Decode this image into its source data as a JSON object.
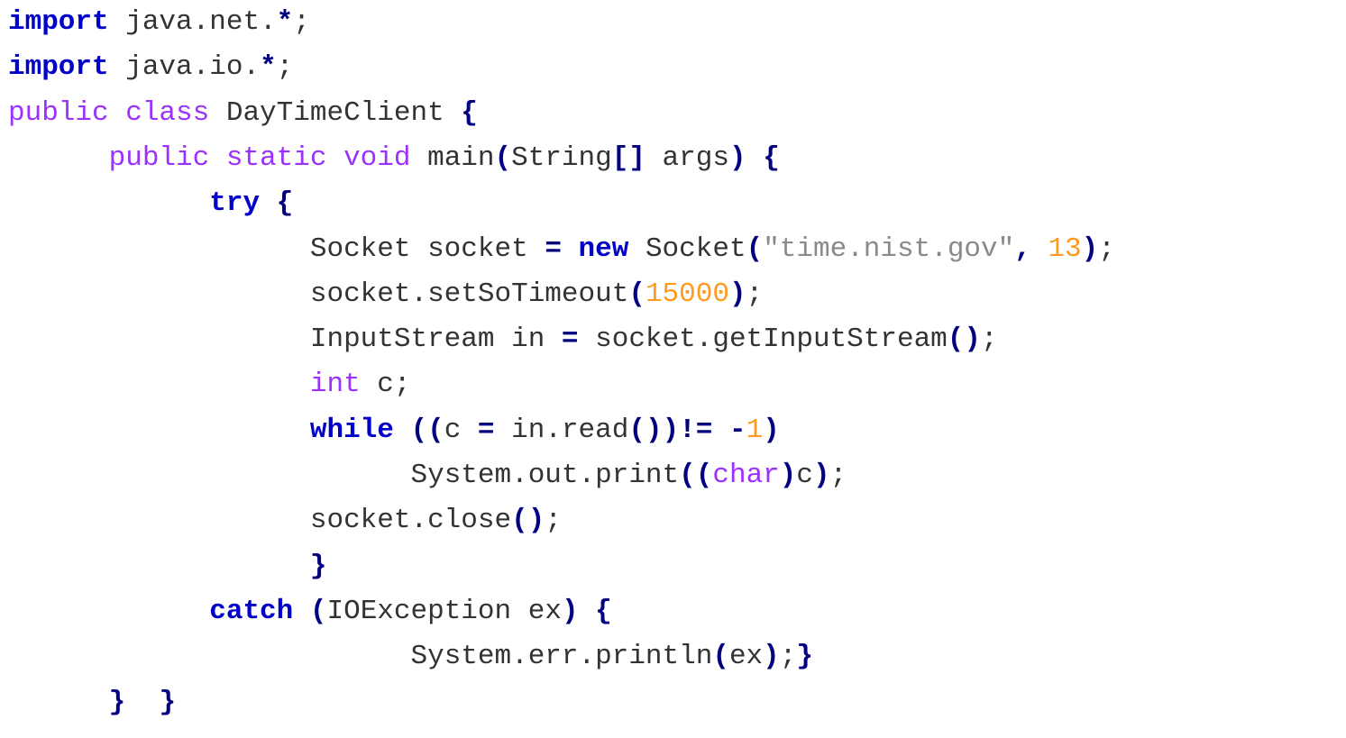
{
  "colors": {
    "background": "#ffffff",
    "keyword": "#0000c8",
    "modifier": "#9b30ff",
    "string": "#8a8a8a",
    "number": "#ff9a1f",
    "operator": "#000080",
    "plain": "#333333"
  },
  "code": {
    "language": "java",
    "lines": [
      {
        "indent": "",
        "tokens": [
          {
            "t": "kw",
            "v": "import"
          },
          {
            "t": "plain",
            "v": " java.net."
          },
          {
            "t": "op",
            "v": "*"
          },
          {
            "t": "plain",
            "v": ";"
          }
        ]
      },
      {
        "indent": "",
        "tokens": [
          {
            "t": "kw",
            "v": "import"
          },
          {
            "t": "plain",
            "v": " java.io."
          },
          {
            "t": "op",
            "v": "*"
          },
          {
            "t": "plain",
            "v": ";"
          }
        ]
      },
      {
        "indent": "",
        "tokens": [
          {
            "t": "mod",
            "v": "public class"
          },
          {
            "t": "plain",
            "v": " DayTimeClient "
          },
          {
            "t": "op",
            "v": "{"
          }
        ]
      },
      {
        "indent": "      ",
        "tokens": [
          {
            "t": "mod",
            "v": "public static void"
          },
          {
            "t": "plain",
            "v": " main"
          },
          {
            "t": "op",
            "v": "("
          },
          {
            "t": "plain",
            "v": "String"
          },
          {
            "t": "op",
            "v": "[]"
          },
          {
            "t": "plain",
            "v": " args"
          },
          {
            "t": "op",
            "v": ")"
          },
          {
            "t": "plain",
            "v": " "
          },
          {
            "t": "op",
            "v": "{"
          }
        ]
      },
      {
        "indent": "            ",
        "tokens": [
          {
            "t": "kw",
            "v": "try"
          },
          {
            "t": "plain",
            "v": " "
          },
          {
            "t": "op",
            "v": "{"
          }
        ]
      },
      {
        "indent": "                  ",
        "tokens": [
          {
            "t": "plain",
            "v": "Socket socket "
          },
          {
            "t": "op",
            "v": "="
          },
          {
            "t": "plain",
            "v": " "
          },
          {
            "t": "kw",
            "v": "new"
          },
          {
            "t": "plain",
            "v": " Socket"
          },
          {
            "t": "op",
            "v": "("
          },
          {
            "t": "str",
            "v": "\"time.nist.gov\""
          },
          {
            "t": "op",
            "v": ","
          },
          {
            "t": "plain",
            "v": " "
          },
          {
            "t": "num",
            "v": "13"
          },
          {
            "t": "op",
            "v": ")"
          },
          {
            "t": "plain",
            "v": ";"
          }
        ]
      },
      {
        "indent": "                  ",
        "tokens": [
          {
            "t": "plain",
            "v": "socket.setSoTimeout"
          },
          {
            "t": "op",
            "v": "("
          },
          {
            "t": "num",
            "v": "15000"
          },
          {
            "t": "op",
            "v": ")"
          },
          {
            "t": "plain",
            "v": ";"
          }
        ]
      },
      {
        "indent": "                  ",
        "tokens": [
          {
            "t": "plain",
            "v": "InputStream in "
          },
          {
            "t": "op",
            "v": "="
          },
          {
            "t": "plain",
            "v": " socket.getInputStream"
          },
          {
            "t": "op",
            "v": "()"
          },
          {
            "t": "plain",
            "v": ";"
          }
        ]
      },
      {
        "indent": "                  ",
        "tokens": [
          {
            "t": "mod",
            "v": "int"
          },
          {
            "t": "plain",
            "v": " c;"
          }
        ]
      },
      {
        "indent": "                  ",
        "tokens": [
          {
            "t": "kw",
            "v": "while"
          },
          {
            "t": "plain",
            "v": " "
          },
          {
            "t": "op",
            "v": "(("
          },
          {
            "t": "plain",
            "v": "c "
          },
          {
            "t": "op",
            "v": "="
          },
          {
            "t": "plain",
            "v": " in.read"
          },
          {
            "t": "op",
            "v": "())!="
          },
          {
            "t": "plain",
            "v": " "
          },
          {
            "t": "op",
            "v": "-"
          },
          {
            "t": "num",
            "v": "1"
          },
          {
            "t": "op",
            "v": ")"
          }
        ]
      },
      {
        "indent": "                        ",
        "tokens": [
          {
            "t": "plain",
            "v": "System.out.print"
          },
          {
            "t": "op",
            "v": "(("
          },
          {
            "t": "mod",
            "v": "char"
          },
          {
            "t": "op",
            "v": ")"
          },
          {
            "t": "plain",
            "v": "c"
          },
          {
            "t": "op",
            "v": ")"
          },
          {
            "t": "plain",
            "v": ";"
          }
        ]
      },
      {
        "indent": "                  ",
        "tokens": [
          {
            "t": "plain",
            "v": "socket.close"
          },
          {
            "t": "op",
            "v": "()"
          },
          {
            "t": "plain",
            "v": ";"
          }
        ]
      },
      {
        "indent": "                  ",
        "tokens": [
          {
            "t": "op",
            "v": "}"
          }
        ]
      },
      {
        "indent": "            ",
        "tokens": [
          {
            "t": "kw",
            "v": "catch"
          },
          {
            "t": "plain",
            "v": " "
          },
          {
            "t": "op",
            "v": "("
          },
          {
            "t": "plain",
            "v": "IOException ex"
          },
          {
            "t": "op",
            "v": ")"
          },
          {
            "t": "plain",
            "v": " "
          },
          {
            "t": "op",
            "v": "{"
          }
        ]
      },
      {
        "indent": "                        ",
        "tokens": [
          {
            "t": "plain",
            "v": "System.err.println"
          },
          {
            "t": "op",
            "v": "("
          },
          {
            "t": "plain",
            "v": "ex"
          },
          {
            "t": "op",
            "v": ")"
          },
          {
            "t": "plain",
            "v": ";"
          },
          {
            "t": "op",
            "v": "}"
          }
        ]
      },
      {
        "indent": "      ",
        "tokens": [
          {
            "t": "op",
            "v": "}"
          },
          {
            "t": "plain",
            "v": "  "
          },
          {
            "t": "op",
            "v": "}"
          }
        ]
      }
    ]
  }
}
